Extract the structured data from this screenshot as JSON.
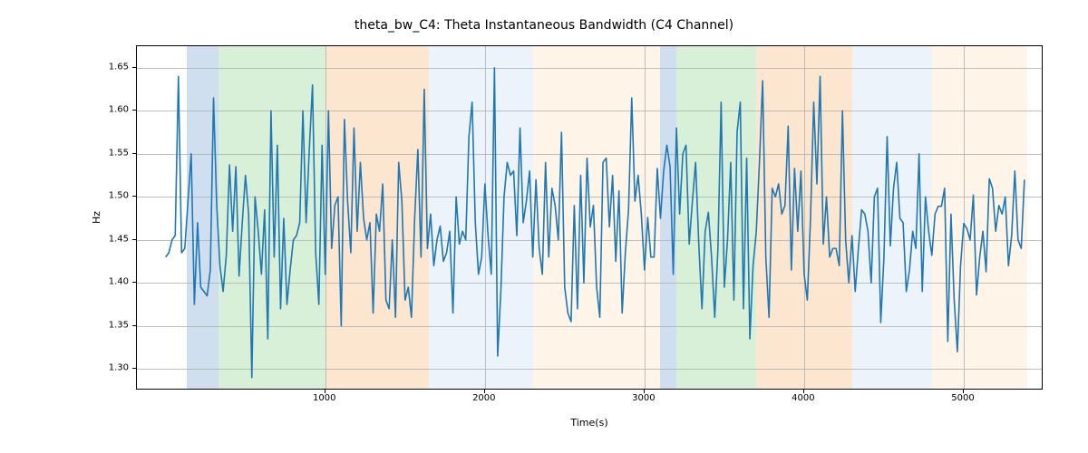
{
  "chart_data": {
    "type": "line",
    "title": "theta_bw_C4: Theta Instantaneous Bandwidth (C4 Channel)",
    "xlabel": "Time(s)",
    "ylabel": "Hz",
    "xlim": [
      -180,
      5500
    ],
    "ylim": [
      1.275,
      1.675
    ],
    "x_ticks": [
      1000,
      2000,
      3000,
      4000,
      5000
    ],
    "y_ticks": [
      1.3,
      1.35,
      1.4,
      1.45,
      1.5,
      1.55,
      1.6,
      1.65
    ],
    "x_tick_labels": [
      "1000",
      "2000",
      "3000",
      "4000",
      "5000"
    ],
    "y_tick_labels": [
      "1.30",
      "1.35",
      "1.40",
      "1.45",
      "1.50",
      "1.55",
      "1.60",
      "1.65"
    ],
    "bands": [
      {
        "x0": 130,
        "x1": 330,
        "color": "#6a9bd1"
      },
      {
        "x0": 330,
        "x1": 1000,
        "color": "#86cf86"
      },
      {
        "x0": 1000,
        "x1": 1650,
        "color": "#f6b26b"
      },
      {
        "x0": 1650,
        "x1": 2300,
        "color": "#c6d9ee"
      },
      {
        "x0": 2300,
        "x1": 3100,
        "color": "#fbdcb7"
      },
      {
        "x0": 3100,
        "x1": 3200,
        "color": "#6a9bd1"
      },
      {
        "x0": 3200,
        "x1": 3700,
        "color": "#86cf86"
      },
      {
        "x0": 3700,
        "x1": 4300,
        "color": "#f6b26b"
      },
      {
        "x0": 4300,
        "x1": 4800,
        "color": "#c6d9ee"
      },
      {
        "x0": 4800,
        "x1": 5400,
        "color": "#fbdcb7"
      }
    ],
    "series": [
      {
        "name": "theta_bw_C4",
        "color": "#1f77b4",
        "x_start": 0,
        "x_step": 20,
        "y": [
          1.43,
          1.435,
          1.45,
          1.455,
          1.64,
          1.435,
          1.44,
          1.495,
          1.55,
          1.375,
          1.47,
          1.395,
          1.39,
          1.385,
          1.415,
          1.615,
          1.49,
          1.42,
          1.39,
          1.432,
          1.537,
          1.46,
          1.535,
          1.408,
          1.47,
          1.525,
          1.48,
          1.29,
          1.5,
          1.46,
          1.41,
          1.485,
          1.335,
          1.6,
          1.43,
          1.56,
          1.37,
          1.475,
          1.375,
          1.415,
          1.45,
          1.455,
          1.47,
          1.6,
          1.47,
          1.555,
          1.63,
          1.435,
          1.375,
          1.56,
          1.41,
          1.6,
          1.44,
          1.49,
          1.5,
          1.35,
          1.59,
          1.495,
          1.435,
          1.58,
          1.46,
          1.54,
          1.475,
          1.45,
          1.47,
          1.365,
          1.48,
          1.46,
          1.515,
          1.38,
          1.37,
          1.45,
          1.36,
          1.54,
          1.495,
          1.38,
          1.395,
          1.36,
          1.475,
          1.555,
          1.43,
          1.625,
          1.44,
          1.48,
          1.42,
          1.45,
          1.466,
          1.425,
          1.435,
          1.46,
          1.365,
          1.5,
          1.445,
          1.46,
          1.45,
          1.57,
          1.61,
          1.47,
          1.41,
          1.43,
          1.515,
          1.455,
          1.41,
          1.65,
          1.315,
          1.39,
          1.5,
          1.54,
          1.525,
          1.53,
          1.455,
          1.58,
          1.47,
          1.495,
          1.53,
          1.43,
          1.52,
          1.44,
          1.41,
          1.54,
          1.43,
          1.51,
          1.49,
          1.45,
          1.575,
          1.395,
          1.365,
          1.355,
          1.49,
          1.37,
          1.525,
          1.4,
          1.545,
          1.465,
          1.49,
          1.395,
          1.36,
          1.54,
          1.545,
          1.465,
          1.525,
          1.425,
          1.507,
          1.365,
          1.435,
          1.485,
          1.615,
          1.495,
          1.525,
          1.48,
          1.415,
          1.476,
          1.43,
          1.43,
          1.533,
          1.475,
          1.53,
          1.56,
          1.535,
          1.41,
          1.58,
          1.48,
          1.55,
          1.56,
          1.445,
          1.495,
          1.54,
          1.445,
          1.37,
          1.46,
          1.482,
          1.43,
          1.36,
          1.44,
          1.61,
          1.395,
          1.45,
          1.54,
          1.38,
          1.575,
          1.61,
          1.37,
          1.545,
          1.335,
          1.42,
          1.459,
          1.54,
          1.635,
          1.43,
          1.36,
          1.51,
          1.5,
          1.515,
          1.48,
          1.49,
          1.582,
          1.415,
          1.533,
          1.46,
          1.53,
          1.41,
          1.38,
          1.475,
          1.61,
          1.515,
          1.64,
          1.445,
          1.5,
          1.43,
          1.44,
          1.44,
          1.42,
          1.6,
          1.45,
          1.4,
          1.455,
          1.39,
          1.44,
          1.485,
          1.48,
          1.46,
          1.4,
          1.5,
          1.51,
          1.354,
          1.43,
          1.57,
          1.443,
          1.51,
          1.54,
          1.475,
          1.47,
          1.39,
          1.415,
          1.46,
          1.44,
          1.55,
          1.39,
          1.5,
          1.46,
          1.432,
          1.48,
          1.489,
          1.489,
          1.51,
          1.332,
          1.48,
          1.38,
          1.32,
          1.42,
          1.469,
          1.463,
          1.45,
          1.502,
          1.386,
          1.43,
          1.46,
          1.413,
          1.521,
          1.51,
          1.46,
          1.49,
          1.48,
          1.5,
          1.42,
          1.455,
          1.53,
          1.45,
          1.44,
          1.52
        ]
      }
    ]
  }
}
